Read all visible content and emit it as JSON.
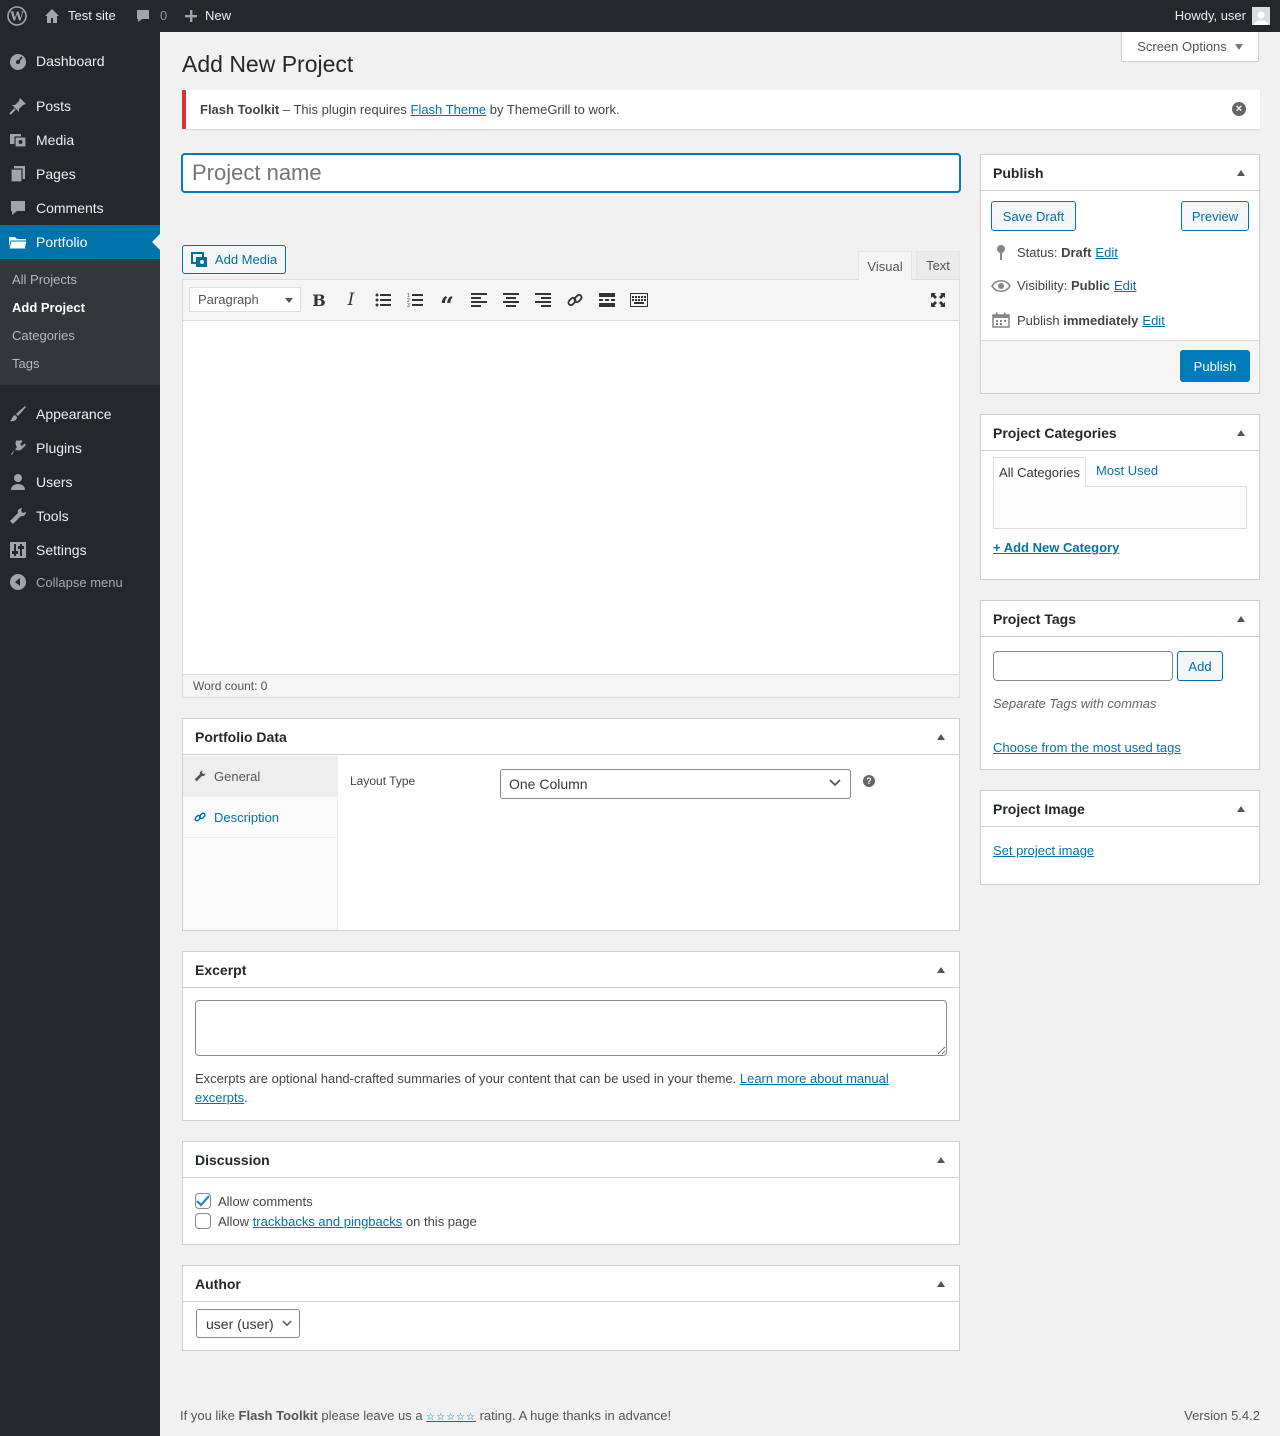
{
  "adminbar": {
    "site_name": "Test site",
    "comments_count": "0",
    "new_label": "New",
    "howdy": "Howdy, user"
  },
  "sidebar": {
    "dashboard": "Dashboard",
    "posts": "Posts",
    "media": "Media",
    "pages": "Pages",
    "comments": "Comments",
    "portfolio": "Portfolio",
    "submenu": [
      "All Projects",
      "Add Project",
      "Categories",
      "Tags"
    ],
    "appearance": "Appearance",
    "plugins": "Plugins",
    "users": "Users",
    "tools": "Tools",
    "settings": "Settings",
    "collapse": "Collapse menu"
  },
  "screen_options": "Screen Options",
  "page_title": "Add New Project",
  "notice": {
    "plugin": "Flash Toolkit",
    "text_before": " – This plugin requires ",
    "link": "Flash Theme",
    "text_after": " by ThemeGrill to work."
  },
  "title_input": {
    "placeholder": "Project name"
  },
  "editor": {
    "add_media": "Add Media",
    "tab_visual": "Visual",
    "tab_text": "Text",
    "format_select": "Paragraph",
    "word_count": "Word count: 0"
  },
  "portfolio_data": {
    "heading": "Portfolio Data",
    "tab_general": "General",
    "tab_description": "Description",
    "layout_label": "Layout Type",
    "layout_value": "One Column",
    "help": "?"
  },
  "excerpt": {
    "heading": "Excerpt",
    "help_text": "Excerpts are optional hand-crafted summaries of your content that can be used in your theme. ",
    "link1": "Learn more about manual",
    "link2": "excerpts",
    "period": "."
  },
  "discussion": {
    "heading": "Discussion",
    "allow_comments": "Allow comments",
    "allow_trackbacks_before": "Allow ",
    "allow_trackbacks_link": "trackbacks and pingbacks",
    "allow_trackbacks_after": " on this page"
  },
  "author": {
    "heading": "Author",
    "value": "user (user)"
  },
  "publish": {
    "heading": "Publish",
    "save_draft": "Save Draft",
    "preview": "Preview",
    "status_label": "Status: ",
    "status_value": "Draft",
    "visibility_label": "Visibility: ",
    "visibility_value": "Public",
    "publish_label": "Publish ",
    "publish_value": "immediately",
    "edit": "Edit",
    "publish_button": "Publish"
  },
  "categories": {
    "heading": "Project Categories",
    "tab_all": "All Categories",
    "tab_most": "Most Used",
    "add_new": "+ Add New Category"
  },
  "tags": {
    "heading": "Project Tags",
    "add": "Add",
    "help": "Separate Tags with commas",
    "choose": "Choose from the most used tags"
  },
  "image": {
    "heading": "Project Image",
    "set": "Set project image"
  },
  "footer": {
    "before": "If you like ",
    "plugin": "Flash Toolkit",
    "middle": " please leave us a ",
    "stars": "☆☆☆☆☆",
    "after": " rating. A huge thanks in advance!",
    "version": "Version 5.4.2"
  },
  "colors": {
    "accent": "#0073aa",
    "admin_dark": "#23282d",
    "notice_error": "#dc3232"
  }
}
